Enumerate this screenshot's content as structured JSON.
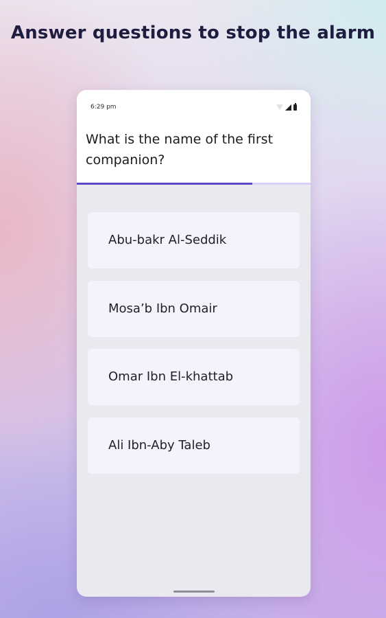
{
  "headline": "Answer questions to stop the alarm",
  "status_bar": {
    "time": "6:29 pm",
    "icons": [
      "wifi-icon",
      "signal-icon",
      "battery-icon"
    ]
  },
  "question": {
    "text": "What is the name of the first companion?"
  },
  "progress": {
    "fraction": 0.75
  },
  "answers": [
    {
      "label": "Abu-bakr Al-Seddik"
    },
    {
      "label": "Mosa’b Ibn Omair"
    },
    {
      "label": "Omar Ibn El-khattab"
    },
    {
      "label": "Ali Ibn-Aby Taleb"
    }
  ],
  "colors": {
    "accent": "#5a48c8",
    "progress_track": "#d8cff6",
    "answer_background": "#f4f2fb",
    "screen_background": "#ebe9f0",
    "headline_text": "#1f1d3f"
  }
}
